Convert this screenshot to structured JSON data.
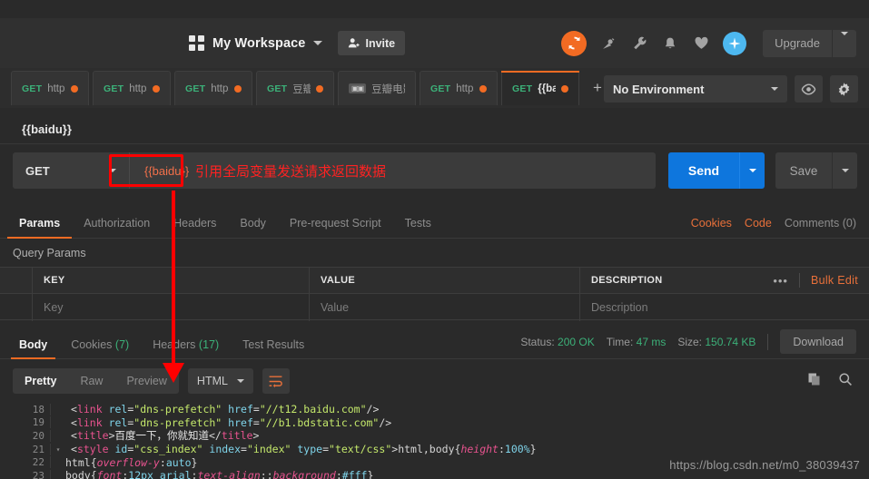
{
  "header": {
    "workspace_name": "My Workspace",
    "invite_label": "Invite",
    "upgrade_label": "Upgrade",
    "icons": [
      "sync-icon",
      "satellite-icon",
      "wrench-icon",
      "bell-icon",
      "heart-icon",
      "new-icon"
    ],
    "accent_orange": "#f26b23",
    "accent_blue": "#4db8f0"
  },
  "tabs": [
    {
      "method": "GET",
      "title": "https",
      "unsaved": true,
      "active": false,
      "type": "request"
    },
    {
      "method": "GET",
      "title": "https",
      "unsaved": true,
      "active": false,
      "type": "request"
    },
    {
      "method": "GET",
      "title": "https",
      "unsaved": true,
      "active": false,
      "type": "request"
    },
    {
      "method": "GET",
      "title": "豆瓣!",
      "unsaved": true,
      "active": false,
      "type": "request"
    },
    {
      "method": "",
      "title": "豆瓣电影",
      "unsaved": false,
      "active": false,
      "type": "collection"
    },
    {
      "method": "GET",
      "title": "https",
      "unsaved": true,
      "active": false,
      "type": "request"
    },
    {
      "method": "GET",
      "title": "{{bai",
      "unsaved": true,
      "active": true,
      "type": "request"
    }
  ],
  "tab_controls": {
    "new_tab": "+",
    "more": "•••"
  },
  "environment": {
    "selected": "No Environment",
    "eye_icon": "eye-icon",
    "settings_icon": "gear-icon"
  },
  "request": {
    "title": "{{baidu}}",
    "method": "GET",
    "url": "{{baidu}}",
    "send_label": "Send",
    "save_label": "Save",
    "tabs": [
      {
        "label": "Params",
        "active": true
      },
      {
        "label": "Authorization",
        "active": false
      },
      {
        "label": "Headers",
        "active": false
      },
      {
        "label": "Body",
        "active": false
      },
      {
        "label": "Pre-request Script",
        "active": false
      },
      {
        "label": "Tests",
        "active": false
      }
    ],
    "links": {
      "cookies": "Cookies",
      "code": "Code",
      "comments": "Comments (0)"
    }
  },
  "query_params": {
    "section_label": "Query Params",
    "columns": [
      "KEY",
      "VALUE",
      "DESCRIPTION"
    ],
    "row_placeholders": {
      "key": "Key",
      "value": "Value",
      "description": "Description"
    },
    "bulk_edit_label": "Bulk Edit",
    "more_label": "•••"
  },
  "response": {
    "tabs": [
      {
        "label": "Body",
        "count": "",
        "active": true
      },
      {
        "label": "Cookies",
        "count": "(7)",
        "active": false
      },
      {
        "label": "Headers",
        "count": "(17)",
        "active": false
      },
      {
        "label": "Test Results",
        "count": "",
        "active": false
      }
    ],
    "status_key": "Status:",
    "status_value": "200 OK",
    "time_key": "Time:",
    "time_value": "47 ms",
    "size_key": "Size:",
    "size_value": "150.74 KB",
    "download_label": "Download",
    "view_modes": [
      {
        "label": "Pretty",
        "active": true
      },
      {
        "label": "Raw",
        "active": false
      },
      {
        "label": "Preview",
        "active": false
      }
    ],
    "format": "HTML",
    "wrap_icon": "word-wrap-icon",
    "copy_icon": "copy-icon",
    "search_icon": "search-icon",
    "code_lines": [
      {
        "num": "18",
        "fold": false
      },
      {
        "num": "19",
        "fold": false
      },
      {
        "num": "20",
        "fold": false
      },
      {
        "num": "21",
        "fold": true
      },
      {
        "num": "22",
        "fold": false
      },
      {
        "num": "23",
        "fold": false
      }
    ],
    "code_text": [
      "        <link rel=\"dns-prefetch\" href=\"//t12.baidu.com\"/>",
      "        <link rel=\"dns-prefetch\" href=\"//b1.bdstatic.com\"/>",
      "        <title>百度一下，你就知道</title>",
      "        <style id=\"css_index\" index=\"index\" type=\"text/css\">html,body{height:100%}",
      "html{overflow-y:auto}",
      "body{font:12px arial;text-align:;background:#fff}"
    ]
  },
  "annotations": {
    "note_text": "引用全局变量发送请求返回数据",
    "note_color": "#ff2222",
    "box_color": "#ff0000"
  },
  "watermark": "https://blog.csdn.net/m0_38039437"
}
